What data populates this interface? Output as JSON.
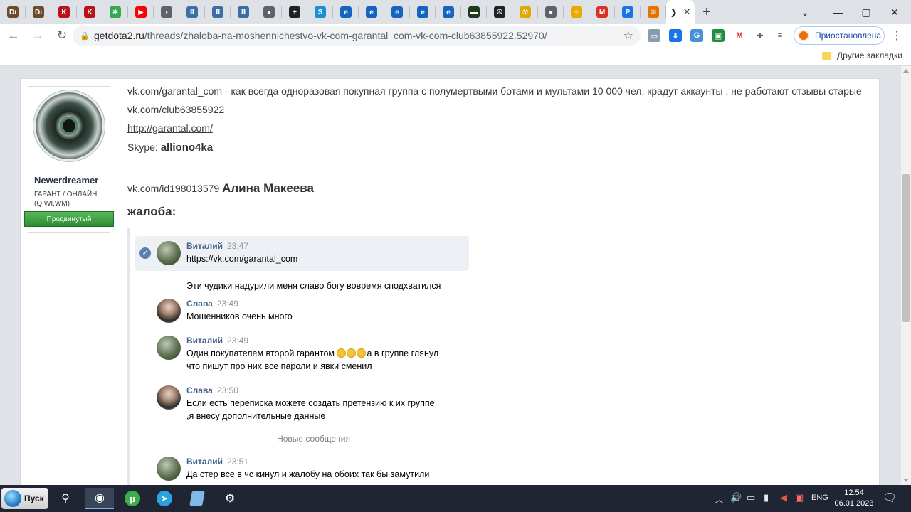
{
  "browser": {
    "tabs": [
      {
        "icon": "dm-icon",
        "glyph": "Dı",
        "color": "#6b4b2a"
      },
      {
        "icon": "dm-icon",
        "glyph": "Dı",
        "color": "#6b4b2a"
      },
      {
        "icon": "k-icon",
        "glyph": "K",
        "color": "#b8121b"
      },
      {
        "icon": "k-icon",
        "glyph": "K",
        "color": "#b8121b"
      },
      {
        "icon": "pinwheel-icon",
        "glyph": "✱",
        "color": "#34a853"
      },
      {
        "icon": "youtube-icon",
        "glyph": "▶",
        "color": "#ff0000"
      },
      {
        "icon": "audio-icon",
        "glyph": "◖",
        "color": "#5f6368"
      },
      {
        "icon": "bookmark-icon",
        "glyph": "Ⅱ",
        "color": "#3a6ea5"
      },
      {
        "icon": "bookmark-icon",
        "glyph": "Ⅱ",
        "color": "#3a6ea5"
      },
      {
        "icon": "bookmark-icon",
        "glyph": "Ⅱ",
        "color": "#3a6ea5"
      },
      {
        "icon": "globe-icon",
        "glyph": "●",
        "color": "#5f6368"
      },
      {
        "icon": "plus-circle-icon",
        "glyph": "+",
        "color": "#202124"
      },
      {
        "icon": "skype-icon",
        "glyph": "S",
        "color": "#1a8fd6"
      },
      {
        "icon": "edge-icon",
        "glyph": "e",
        "color": "#1565c0"
      },
      {
        "icon": "edge-icon",
        "glyph": "e",
        "color": "#1565c0"
      },
      {
        "icon": "edge-icon",
        "glyph": "e",
        "color": "#1565c0"
      },
      {
        "icon": "edge-icon",
        "glyph": "e",
        "color": "#1565c0"
      },
      {
        "icon": "edge-icon",
        "glyph": "e",
        "color": "#1565c0"
      },
      {
        "icon": "terminal-icon",
        "glyph": "▬",
        "color": "#1e3a1e"
      },
      {
        "icon": "peace-icon",
        "glyph": "☮",
        "color": "#202124"
      },
      {
        "icon": "radiation-icon",
        "glyph": "☢",
        "color": "#e0a800"
      },
      {
        "icon": "globe-icon",
        "glyph": "●",
        "color": "#5f6368"
      },
      {
        "icon": "compass-icon",
        "glyph": "✧",
        "color": "#e8a900"
      },
      {
        "icon": "gmail-icon",
        "glyph": "M",
        "color": "#d93025"
      },
      {
        "icon": "paste-icon",
        "glyph": "P",
        "color": "#1a73e8"
      },
      {
        "icon": "mail-icon",
        "glyph": "✉",
        "color": "#e37400"
      }
    ],
    "active_tab_icon": "❯",
    "url_domain": "getdota2.ru",
    "url_path": "/threads/zhaloba-na-moshennichestvo-vk-com-garantal_com-vk-com-club63855922.52970/",
    "profile_status": "Приостановлена",
    "other_bookmarks": "Другие закладки"
  },
  "post": {
    "user": {
      "name": "Newerdreamer",
      "title": "ГАРАНТ / ОНЛАЙН (QIWI,WM)",
      "badge": "Продвинутый"
    },
    "line1": "vk.com/garantal_com - как всегда одноразовая покупная группа с полумертвыми ботами и мультами 10 000 чел, крадут аккаунты , не работают отзывы старые",
    "line2": "vk.com/club63855922",
    "line3_link": "http://garantal.com/",
    "skype_label": "Skype: ",
    "skype_value": "alliono4ka",
    "id_link": "vk.com/id198013579 ",
    "id_name": "Алина Макеева",
    "complaint_heading": "жалоба:",
    "chat": [
      {
        "author": "Виталий",
        "time": "23:47",
        "lines": [
          "https://vk.com/garantal_com"
        ],
        "avatar": "vitaliy"
      },
      {
        "author": "",
        "time": "",
        "lines": [
          "Эти чудики надурили меня славо богу вовремя сподхватился"
        ],
        "avatar": ""
      },
      {
        "author": "Слава",
        "time": "23:49",
        "lines": [
          "Мошенников очень много"
        ],
        "avatar": "slava"
      },
      {
        "author": "Виталий",
        "time": "23:49",
        "lines": [
          "Один покупателем второй гарантом",
          "что пишут про них все пароли и явки сменил"
        ],
        "after_emoji": "а в группе глянул",
        "avatar": "vitaliy"
      },
      {
        "author": "Слава",
        "time": "23:50",
        "lines": [
          "Если есть переписка можете создать претензию к их группе",
          ",я внесу дополнительные данные"
        ],
        "avatar": "slava"
      },
      {
        "author": "Виталий",
        "time": "23:51",
        "lines": [
          "Да стер все в чс кинул и жалобу на обоих так бы замутили"
        ],
        "avatar": "vitaliy"
      }
    ],
    "new_messages": "Новые сообщения"
  },
  "taskbar": {
    "start": "Пуск",
    "lang": "ENG",
    "time": "12:54",
    "date": "06.01.2023"
  }
}
